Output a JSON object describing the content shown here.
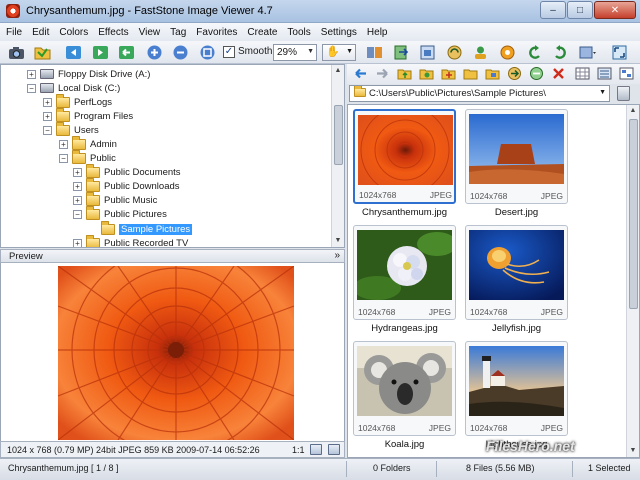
{
  "window": {
    "title": "Chrysanthemum.jpg  -  FastStone Image Viewer 4.7",
    "minimize": "–",
    "maximize": "□",
    "close": "✕"
  },
  "menu": [
    "File",
    "Edit",
    "Colors",
    "Effects",
    "View",
    "Tag",
    "Favorites",
    "Create",
    "Tools",
    "Settings",
    "Help"
  ],
  "toolbar": {
    "smooth_label": "Smooth",
    "smooth_checked": "✓",
    "zoom_value": "29%",
    "hand_glyph": "✋"
  },
  "tree": {
    "items": [
      {
        "label": "Floppy Disk Drive (A:)"
      },
      {
        "label": "Local Disk (C:)"
      },
      {
        "label": "PerfLogs"
      },
      {
        "label": "Program Files"
      },
      {
        "label": "Users"
      },
      {
        "label": "Admin"
      },
      {
        "label": "Public"
      },
      {
        "label": "Public Documents"
      },
      {
        "label": "Public Downloads"
      },
      {
        "label": "Public Music"
      },
      {
        "label": "Public Pictures"
      },
      {
        "label": "Sample Pictures"
      },
      {
        "label": "Public Recorded TV"
      }
    ]
  },
  "preview": {
    "header": "Preview",
    "collapse_glyph": "»",
    "info": "1024 x 768 (0.79 MP)  24bit  JPEG   859 KB   2009-07-14 06:52:26",
    "ratio": "1:1"
  },
  "browser": {
    "path": "C:\\Users\\Public\\Pictures\\Sample Pictures\\",
    "thumbnails": [
      {
        "name": "Chrysanthemum.jpg",
        "size": "1024x768",
        "format": "JPEG"
      },
      {
        "name": "Desert.jpg",
        "size": "1024x768",
        "format": "JPEG"
      },
      {
        "name": "Hydrangeas.jpg",
        "size": "1024x768",
        "format": "JPEG"
      },
      {
        "name": "Jellyfish.jpg",
        "size": "1024x768",
        "format": "JPEG"
      },
      {
        "name": "Koala.jpg",
        "size": "1024x768",
        "format": "JPEG"
      },
      {
        "name": "Lighthouse.jpg",
        "size": "1024x768",
        "format": "JPEG"
      }
    ]
  },
  "status": {
    "file": "Chrysanthemum.jpg [ 1 / 8 ]",
    "folders": "0 Folders",
    "files": "8 Files (5.56 MB)",
    "selected": "1 Selected"
  },
  "watermark": "FilesHero.net",
  "colors": {
    "selection": "#3399ff",
    "selected_border": "#2f6fd0"
  }
}
